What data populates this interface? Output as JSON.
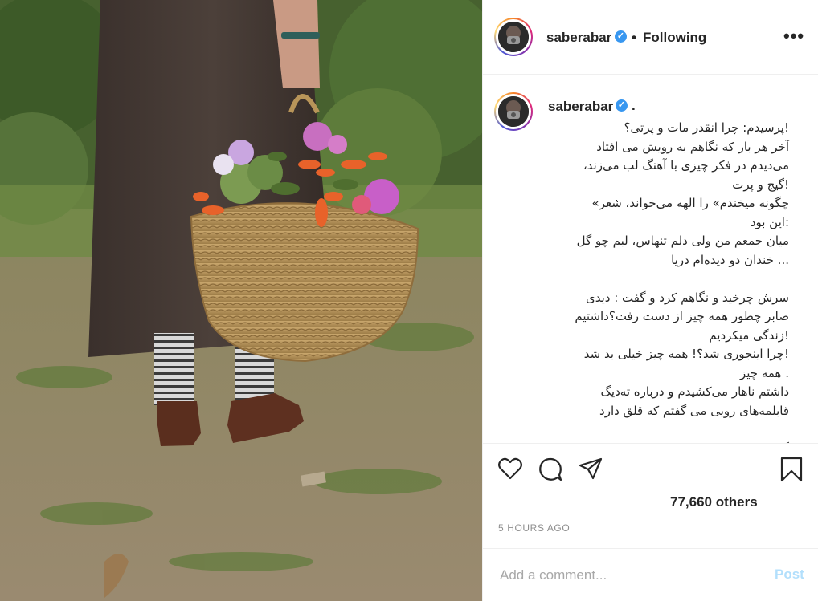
{
  "post": {
    "header": {
      "username": "saberabar",
      "separator": "•",
      "follow_state": "Following",
      "more_icon": "more-horizontal-icon"
    },
    "caption": {
      "username": "saberabar",
      "dot": ".",
      "lines": [
        "!پرسیدم: چرا انقدر مات و پرتی؟",
        "آخر هر بار که نگاهم به رویش می افتاد",
        "می‌دیدم در فکر چیزی با آهنگ لب می‌زند،",
        "!گیج و پرت",
        "چگونه میخندم» را الهه می‌خواند، شعر»",
        ":این بود",
        "میان جمعم من ولی دلم تنهاس، لبم چو گل",
        "... خندان دو دیده‌ام دریا",
        "",
        "سرش چرخید و نگاهم کرد و گفت : دیدی",
        "صابر چطور همه چیز از دست رفت؟داشتیم",
        "!زندگی میکردیم",
        "!چرا اینجوری شد؟! همه چیز خیلی بد شد",
        ". همه چیز",
        "داشتم ناهار می‌کشیدم و درباره ته‌دیگ",
        "قابلمه‌های رویی می گفتم که قلق دارد",
        "",
        "گفتم: تن نباید داد! باید برای روز خوشی"
      ]
    },
    "actions": {
      "like_icon": "heart-icon",
      "comment_icon": "comment-icon",
      "share_icon": "share-icon",
      "save_icon": "bookmark-icon"
    },
    "likes_text": "77,660 others",
    "timestamp": "5 HOURS AGO",
    "comment": {
      "placeholder": "Add a comment...",
      "post_label": "Post"
    }
  },
  "colors": {
    "verified": "#3897f0",
    "post_button": "#b2dffc",
    "muted": "#8e8e8e"
  }
}
